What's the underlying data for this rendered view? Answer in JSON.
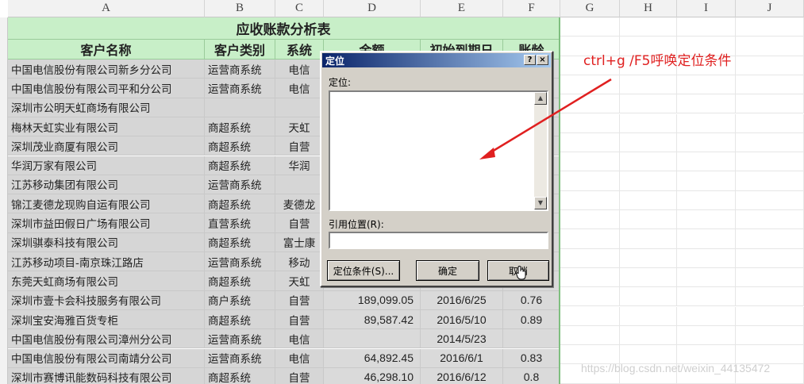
{
  "columns": [
    "A",
    "B",
    "C",
    "D",
    "E",
    "F",
    "G",
    "H",
    "I",
    "J"
  ],
  "sheet_title": "应收账款分析表",
  "headers": [
    "客户名称",
    "客户类别",
    "系统",
    "金额",
    "初始到期日",
    "账龄"
  ],
  "rows": [
    {
      "name": "中国电信股份有限公司新乡分公司",
      "type": "运营商系统",
      "sys": "电信",
      "amount": "",
      "date": "",
      "ratio": ""
    },
    {
      "name": "中国电信股份有限公司平和分公司",
      "type": "运营商系统",
      "sys": "电信",
      "amount": "",
      "date": "",
      "ratio": ""
    },
    {
      "name": "深圳市公明天虹商场有限公司",
      "type": "",
      "sys": "",
      "amount": "",
      "date": "",
      "ratio": ""
    },
    {
      "name": "梅林天虹实业有限公司",
      "type": "商超系统",
      "sys": "天虹",
      "amount": "",
      "date": "",
      "ratio": ""
    },
    {
      "name": "深圳茂业商厦有限公司",
      "type": "商超系统",
      "sys": "自营",
      "amount": "",
      "date": "",
      "ratio": ""
    },
    {
      "name": "华润万家有限公司",
      "type": "商超系统",
      "sys": "华润",
      "amount": "",
      "date": "",
      "ratio": ""
    },
    {
      "name": "江苏移动集团有限公司",
      "type": "运营商系统",
      "sys": "",
      "amount": "",
      "date": "",
      "ratio": ""
    },
    {
      "name": "锦江麦德龙现购自运有限公司",
      "type": "商超系统",
      "sys": "麦德龙",
      "amount": "",
      "date": "",
      "ratio": ""
    },
    {
      "name": "深圳市益田假日广场有限公司",
      "type": "直营系统",
      "sys": "自营",
      "amount": "",
      "date": "",
      "ratio": ""
    },
    {
      "name": "深圳骐泰科技有限公司",
      "type": "商超系统",
      "sys": "富士康",
      "amount": "",
      "date": "",
      "ratio": ""
    },
    {
      "name": "江苏移动项目-南京珠江路店",
      "type": "运营商系统",
      "sys": "移动",
      "amount": "",
      "date": "",
      "ratio": ""
    },
    {
      "name": "东莞天虹商场有限公司",
      "type": "商超系统",
      "sys": "天虹",
      "amount": "",
      "date": "",
      "ratio": ""
    },
    {
      "name": "深圳市壹卡会科技服务有限公司",
      "type": "商户系统",
      "sys": "自营",
      "amount": "189,099.05",
      "date": "2016/6/25",
      "ratio": "0.76"
    },
    {
      "name": "深圳宝安海雅百货专柜",
      "type": "商超系统",
      "sys": "自营",
      "amount": "89,587.42",
      "date": "2016/5/10",
      "ratio": "0.89"
    },
    {
      "name": "中国电信股份有限公司漳州分公司",
      "type": "运营商系统",
      "sys": "电信",
      "amount": "",
      "date": "2014/5/23",
      "ratio": ""
    },
    {
      "name": "中国电信股份有限公司南靖分公司",
      "type": "运营商系统",
      "sys": "电信",
      "amount": "64,892.45",
      "date": "2016/6/1",
      "ratio": "0.83"
    },
    {
      "name": "深圳市赛博讯能数码科技有限公司",
      "type": "商超系统",
      "sys": "自营",
      "amount": "46,298.10",
      "date": "2016/6/12",
      "ratio": "0.8"
    }
  ],
  "dialog": {
    "title": "定位",
    "help_btn": "?",
    "close_btn": "×",
    "goto_label": "定位:",
    "ref_label": "引用位置(R):",
    "ref_value": "",
    "special_btn": "定位条件(S)...",
    "ok_btn": "确定",
    "cancel_btn": "取消"
  },
  "annotation": "ctrl+g /F5呼唤定位条件",
  "watermark": "https://blog.csdn.net/weixin_44135472",
  "colors": {
    "accent_red": "#e02020",
    "header_green": "#c8efc8"
  }
}
